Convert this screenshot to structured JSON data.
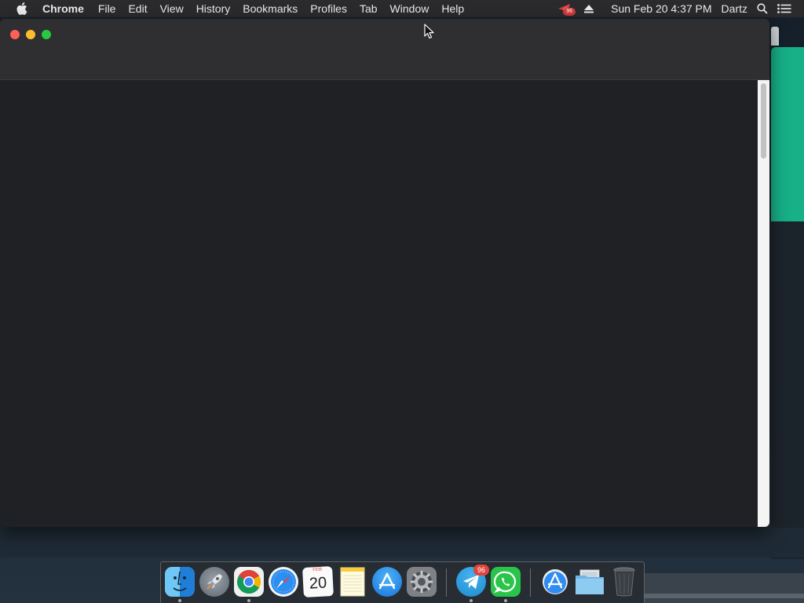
{
  "menubar": {
    "app_name": "Chrome",
    "items": [
      "File",
      "Edit",
      "View",
      "History",
      "Bookmarks",
      "Profiles",
      "Tab",
      "Window",
      "Help"
    ],
    "status": {
      "notification_badge": "96",
      "datetime": "Sun Feb 20  4:37 PM",
      "user": "Dartz"
    }
  },
  "window": {
    "title": ""
  },
  "dock": {
    "apps": [
      {
        "name": "Finder",
        "icon": "finder-icon"
      },
      {
        "name": "Launchpad",
        "icon": "launchpad-icon"
      },
      {
        "name": "Google Chrome",
        "icon": "chrome-icon"
      },
      {
        "name": "Safari",
        "icon": "safari-icon"
      },
      {
        "name": "Calendar",
        "icon": "calendar-icon",
        "month": "FEB",
        "day": "20"
      },
      {
        "name": "Notes",
        "icon": "notes-icon"
      },
      {
        "name": "App Store",
        "icon": "app-store-icon"
      },
      {
        "name": "System Preferences",
        "icon": "system-preferences-icon"
      },
      {
        "name": "Telegram",
        "icon": "telegram-icon",
        "badge": "96"
      },
      {
        "name": "WhatsApp",
        "icon": "whatsapp-icon"
      },
      {
        "name": "Applications",
        "icon": "applications-folder-icon"
      },
      {
        "name": "Downloads",
        "icon": "downloads-folder-icon"
      },
      {
        "name": "Trash",
        "icon": "trash-icon"
      }
    ]
  },
  "colors": {
    "close": "#fe5f57",
    "minimize": "#febc2e",
    "zoom": "#28c840",
    "badge": "#e0453c",
    "background_app_accent": "#17b087"
  }
}
